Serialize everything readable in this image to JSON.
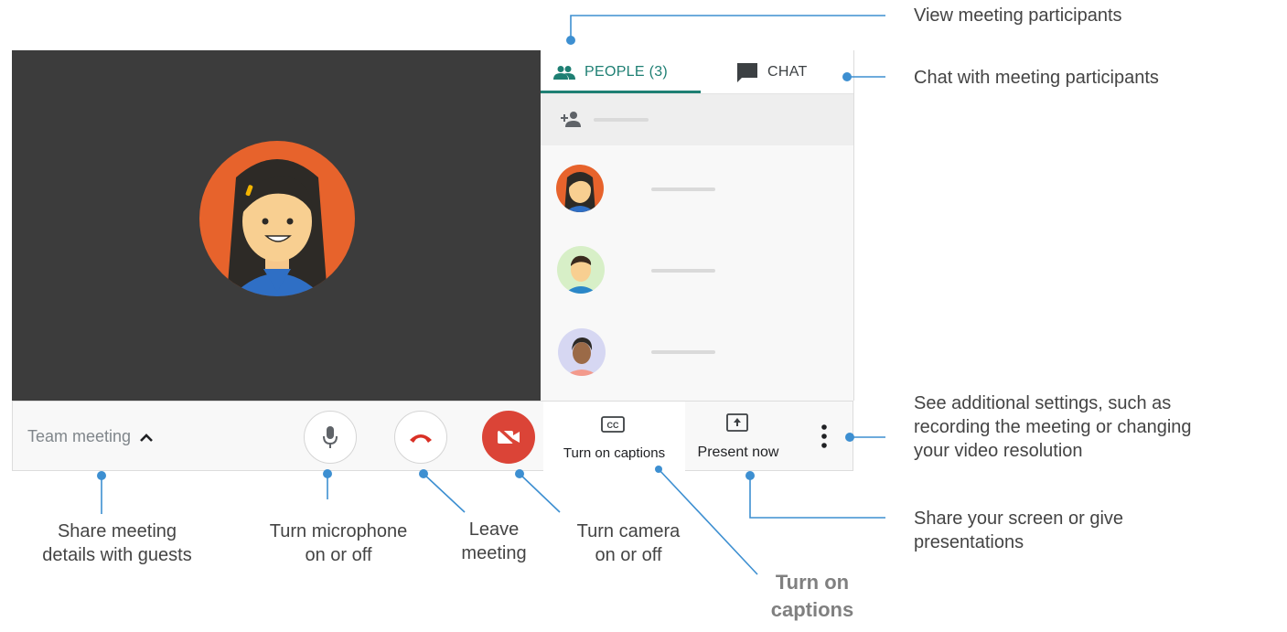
{
  "panel": {
    "tab_people": "PEOPLE (3)",
    "tab_chat": "CHAT"
  },
  "controls": {
    "meeting_title": "Team meeting",
    "captions_label": "Turn on captions",
    "present_label": "Present now"
  },
  "annotations": {
    "view_participants": "View meeting participants",
    "chat_participants": "Chat with meeting participants",
    "more_settings": [
      "See additional settings, such as",
      "recording the meeting or changing",
      "your video resolution"
    ],
    "share_screen": [
      "Share your screen or give",
      "presentations"
    ],
    "share_details": [
      "Share meeting",
      "details with guests"
    ],
    "mic": [
      "Turn microphone",
      "on or off"
    ],
    "leave": [
      "Leave",
      "meeting"
    ],
    "camera": [
      "Turn camera",
      "on or off"
    ],
    "captions": [
      "Turn on",
      "captions"
    ]
  },
  "colors": {
    "accent_teal": "#1e7f73",
    "callout_blue": "#3d8fd1",
    "leave_red": "#d93025",
    "camera_red": "#db4437",
    "stage_dark": "#3c3c3c"
  },
  "icons": [
    "people-icon",
    "chat-icon",
    "add-person-icon",
    "mic-icon",
    "hangup-icon",
    "camera-off-icon",
    "captions-icon",
    "present-icon",
    "more-vert-icon",
    "chevron-up-icon"
  ]
}
